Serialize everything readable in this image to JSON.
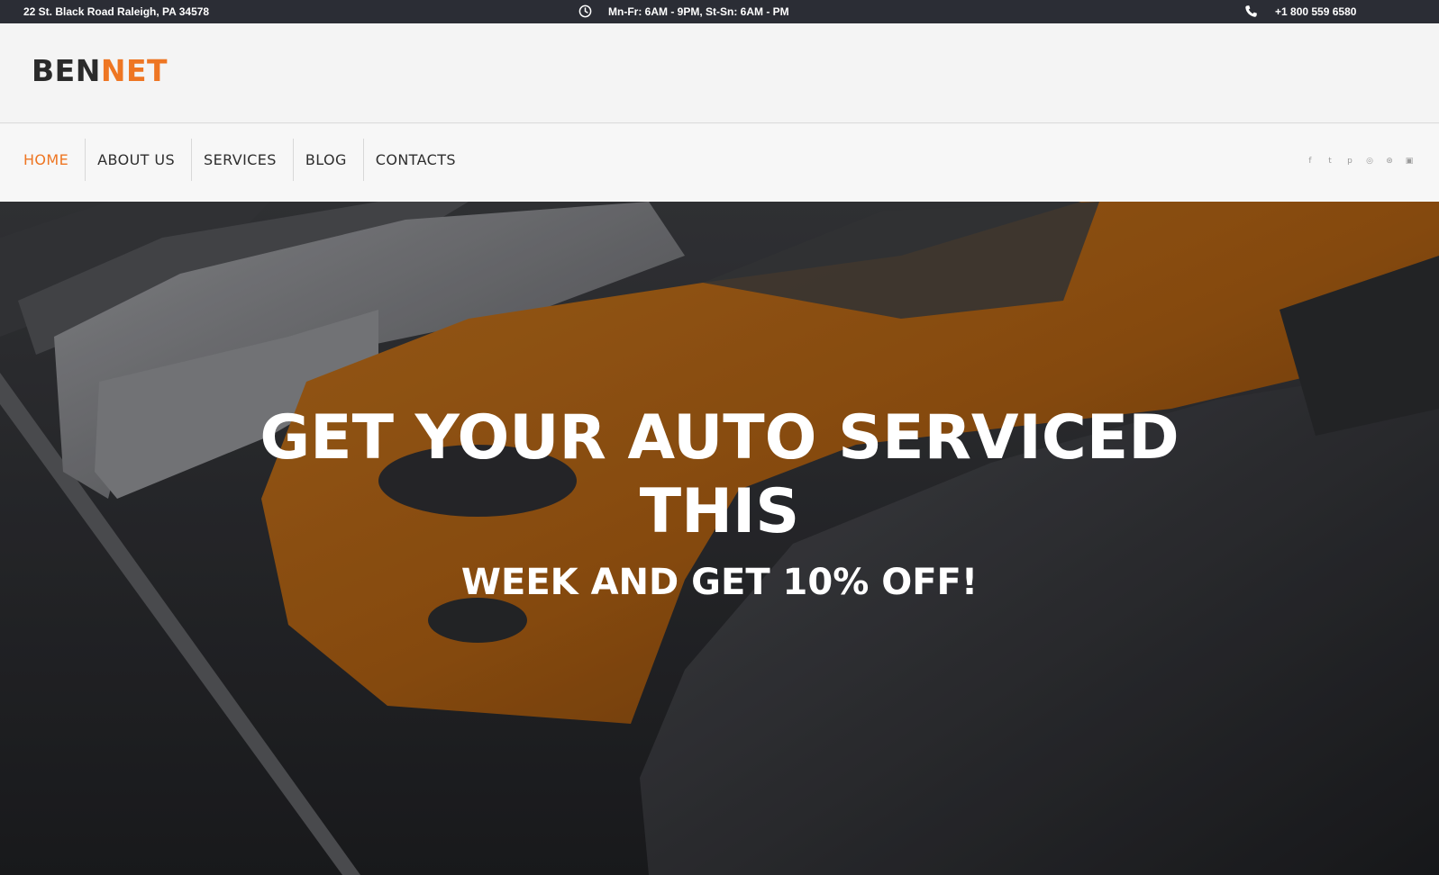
{
  "topbar": {
    "address": "22 St. Black Road Raleigh, PA 34578",
    "hours": "Mn-Fr: 6AM - 9PM, St-Sn: 6AM - PM",
    "phone": "+1 800 559 6580"
  },
  "logo": {
    "part1": "BEN",
    "part2": "NET"
  },
  "nav": {
    "items": [
      {
        "label": "HOME",
        "active": true
      },
      {
        "label": "ABOUT US"
      },
      {
        "label": "SERVICES"
      },
      {
        "label": "BLOG"
      },
      {
        "label": "CONTACTS"
      }
    ]
  },
  "social": {
    "icons": [
      "facebook-icon",
      "twitter-icon",
      "pinterest-icon",
      "instagram-icon",
      "dribbble-icon",
      "youtube-icon"
    ],
    "glyphs": [
      "f",
      "t",
      "p",
      "◎",
      "⊛",
      "▣"
    ]
  },
  "hero": {
    "line1": "GET YOUR AUTO SERVICED",
    "line2": "THIS",
    "line3": "WEEK AND GET 10% OFF!"
  },
  "colors": {
    "accent": "#ee7623",
    "topbar_bg": "#2b2d35",
    "header_bg": "#f4f4f4",
    "hero_overlay": "#2f3034"
  }
}
